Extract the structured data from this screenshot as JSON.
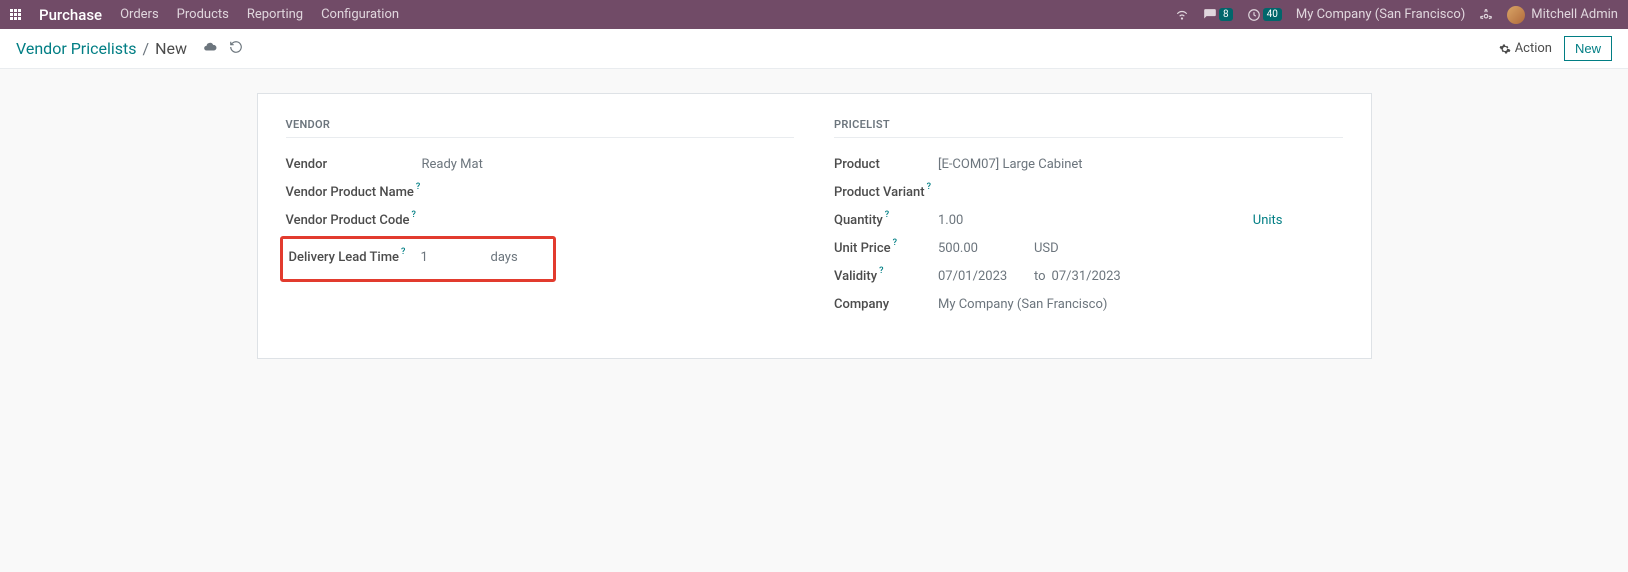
{
  "topbar": {
    "app": "Purchase",
    "menus": [
      "Orders",
      "Products",
      "Reporting",
      "Configuration"
    ],
    "msg_count": "8",
    "activity_count": "40",
    "company": "My Company (San Francisco)",
    "user": "Mitchell Admin"
  },
  "actionbar": {
    "breadcrumb_root": "Vendor Pricelists",
    "breadcrumb_current": "New",
    "action_label": "Action",
    "new_label": "New"
  },
  "form": {
    "vendor_section": "VENDOR",
    "pricelist_section": "PRICELIST",
    "labels": {
      "vendor": "Vendor",
      "vendor_product_name": "Vendor Product Name",
      "vendor_product_code": "Vendor Product Code",
      "delivery_lead_time": "Delivery Lead Time",
      "product": "Product",
      "product_variant": "Product Variant",
      "quantity": "Quantity",
      "unit_price": "Unit Price",
      "validity": "Validity",
      "company": "Company"
    },
    "values": {
      "vendor": "Ready Mat",
      "delivery_lead_time": "1",
      "delivery_lead_time_unit": "days",
      "product": "[E-COM07] Large Cabinet",
      "quantity": "1.00",
      "quantity_uom": "Units",
      "unit_price": "500.00",
      "unit_price_currency": "USD",
      "validity_from": "07/01/2023",
      "validity_sep": "to",
      "validity_to": "07/31/2023",
      "company": "My Company (San Francisco)"
    }
  }
}
